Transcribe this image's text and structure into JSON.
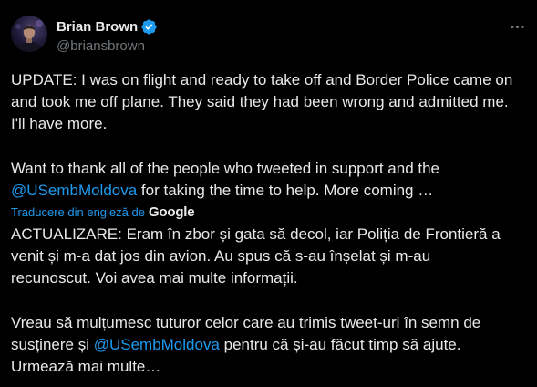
{
  "tweet": {
    "author": {
      "name": "Brian Brown",
      "handle": "@briansbrown",
      "verified": true
    },
    "original_text": {
      "paragraph_1": [
        "UPDATE: I was on flight and ready to take off and Border Police came on",
        "and took me off plane. They said they had been wrong and admitted me.",
        "I'll have more."
      ],
      "paragraph_2": [
        {
          "text": "Want to thank all of the people who tweeted in support and the"
        },
        {
          "mention": "@USembMoldova",
          "after": " for taking the time to help. More coming …"
        }
      ]
    },
    "translation": {
      "label": "Traducere din engleză de",
      "provider": "Google",
      "paragraph_1": [
        "ACTUALIZARE: Eram în zbor și gata să decol, iar Poliția de Frontieră a",
        "venit și m-a dat jos din avion. Au spus că s-au înșelat și m-au",
        "recunoscut. Voi avea mai multe informații."
      ],
      "paragraph_2": [
        {
          "text": "Vreau să mulțumesc tuturor celor care au trimis tweet-uri în semn de"
        },
        {
          "before": "susținere și ",
          "mention": "@USembMoldova",
          "after": " pentru că și-au făcut timp să ajute."
        },
        {
          "text": "Urmează mai multe…"
        }
      ]
    }
  },
  "icons": {
    "avatar": "profile-photo",
    "verified": "verified-badge",
    "more": "more-options-dots",
    "translation_logo": "google-wordmark"
  },
  "colors": {
    "background": "#000000",
    "text": "#e7e9ea",
    "secondary_text": "#71767b",
    "link": "#1d9bf0",
    "verified_badge": "#1d9bf0"
  }
}
